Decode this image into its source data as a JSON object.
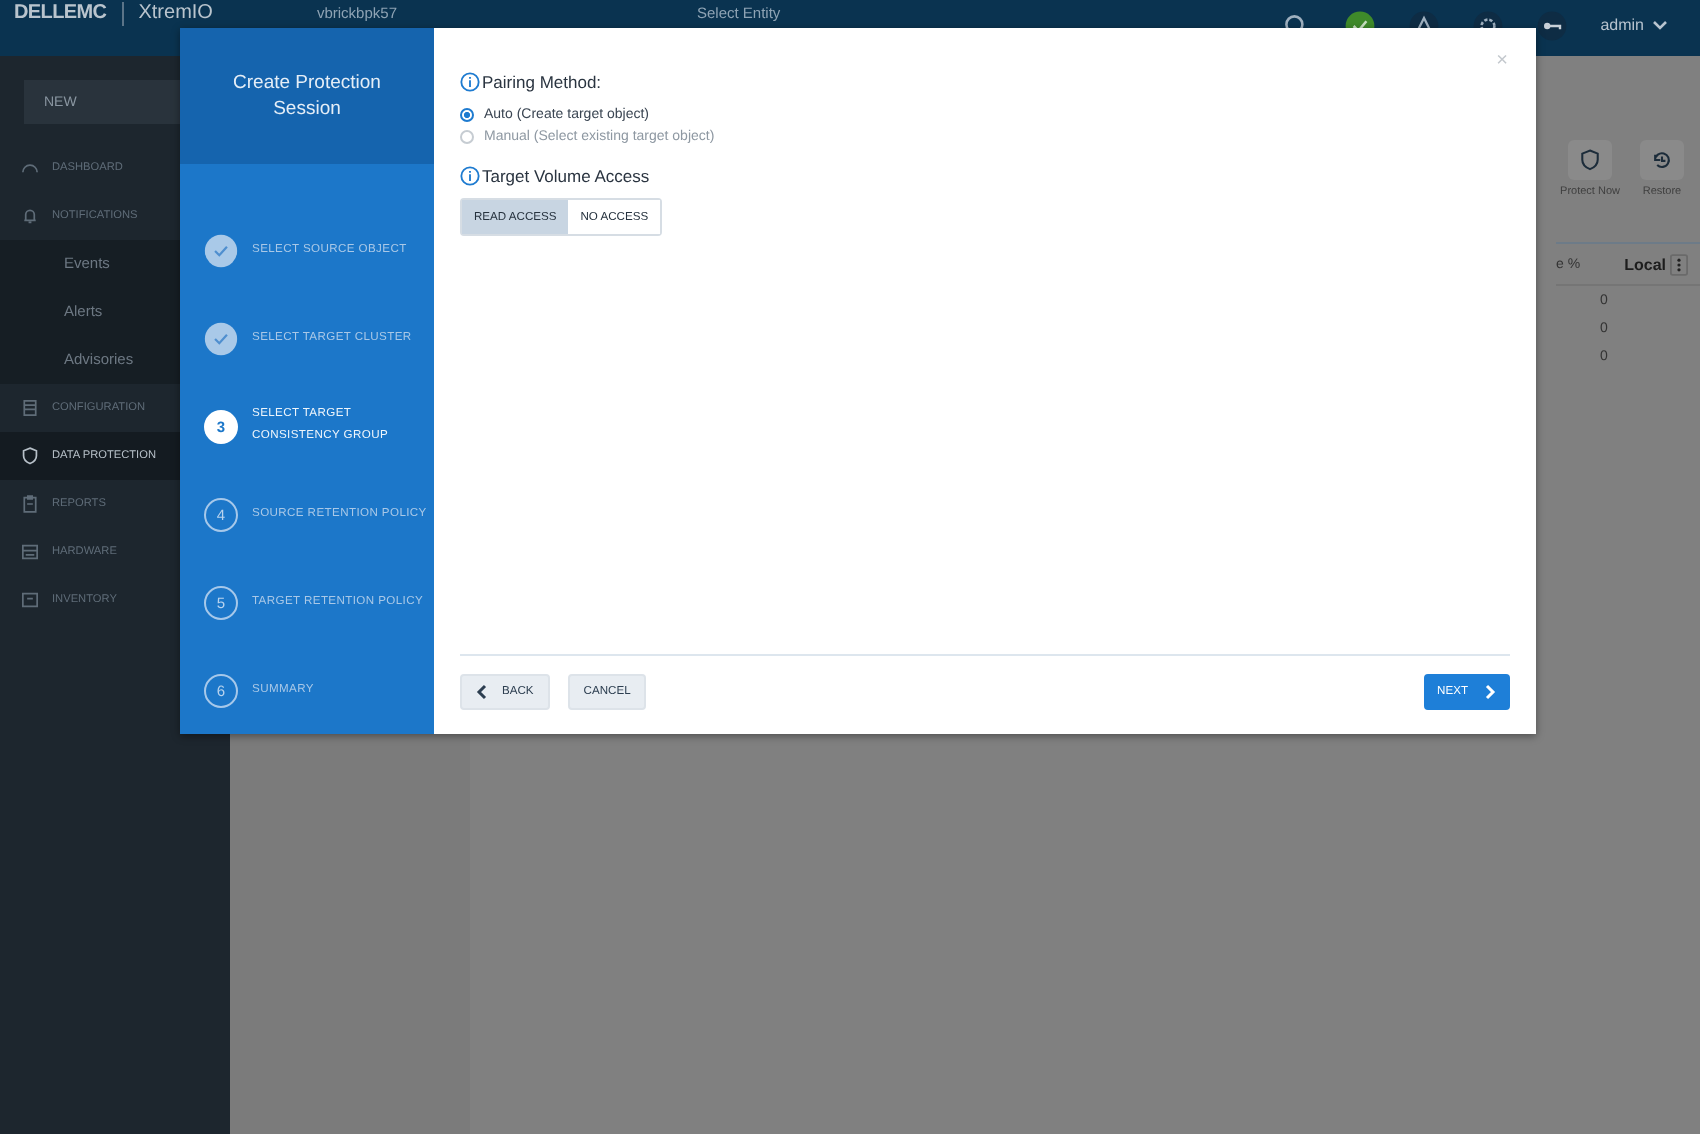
{
  "header": {
    "brand": "DELLEMC",
    "product": "XtremIO",
    "cluster": "vbrickbpk57",
    "entity_placeholder": "Select Entity",
    "status_ok": true,
    "user": "admin"
  },
  "sidebar": {
    "new_button": "NEW",
    "items": [
      {
        "label": "DASHBOARD",
        "selected": false
      },
      {
        "label": "NOTIFICATIONS",
        "selected": false,
        "children": [
          {
            "label": "Events"
          },
          {
            "label": "Alerts"
          },
          {
            "label": "Advisories"
          }
        ]
      },
      {
        "label": "CONFIGURATION",
        "selected": false
      },
      {
        "label": "DATA PROTECTION",
        "selected": true
      },
      {
        "label": "REPORTS",
        "selected": false
      },
      {
        "label": "HARDWARE",
        "selected": false
      },
      {
        "label": "INVENTORY",
        "selected": false
      }
    ]
  },
  "main": {
    "actions": [
      {
        "label": "Protect Now"
      },
      {
        "label": "Restore"
      }
    ],
    "table": {
      "columns": [
        {
          "label": "e %"
        },
        {
          "label": "Local"
        }
      ],
      "rows": [
        {
          "local": "0"
        },
        {
          "local": "0"
        },
        {
          "local": "0"
        }
      ]
    }
  },
  "modal": {
    "title": "Create Protection Session",
    "close": "×",
    "steps": [
      {
        "label": "SELECT SOURCE OBJECT",
        "kind": "done"
      },
      {
        "label": "SELECT TARGET CLUSTER",
        "kind": "done"
      },
      {
        "number": "3",
        "label": "SELECT TARGET CONSISTENCY GROUP",
        "kind": "current"
      },
      {
        "number": "4",
        "label": "SOURCE RETENTION POLICY",
        "kind": "pending"
      },
      {
        "number": "5",
        "label": "TARGET RETENTION POLICY",
        "kind": "pending"
      },
      {
        "number": "6",
        "label": "SUMMARY",
        "kind": "pending"
      }
    ],
    "pairing": {
      "label": "Pairing Method:",
      "options": [
        {
          "label": "Auto (Create target object)",
          "selected": true
        },
        {
          "label": "Manual (Select existing target object)",
          "selected": false
        }
      ]
    },
    "access": {
      "label": "Target Volume Access",
      "options": [
        {
          "label": "READ ACCESS",
          "selected": true
        },
        {
          "label": "NO ACCESS",
          "selected": false
        }
      ]
    },
    "footer": {
      "back": "BACK",
      "cancel": "CANCEL",
      "next": "NEXT"
    }
  }
}
